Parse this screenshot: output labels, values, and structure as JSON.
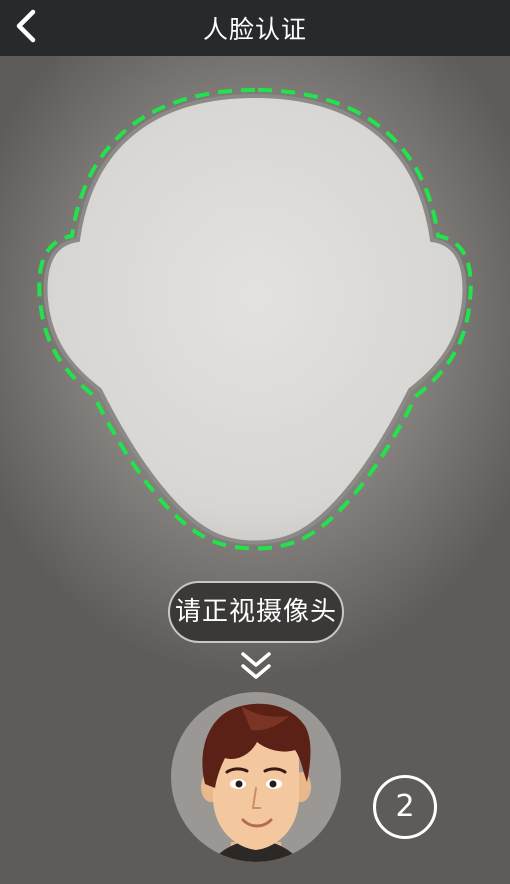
{
  "header": {
    "title": "人脸认证",
    "back_icon": "chevron-left-icon"
  },
  "capture": {
    "hint": "请正视摄像头",
    "guide_color": "#22e44a",
    "scroll_hint_icon": "double-chevron-down-icon",
    "avatar_icon": "cartoon-face-avatar",
    "countdown": "2"
  }
}
